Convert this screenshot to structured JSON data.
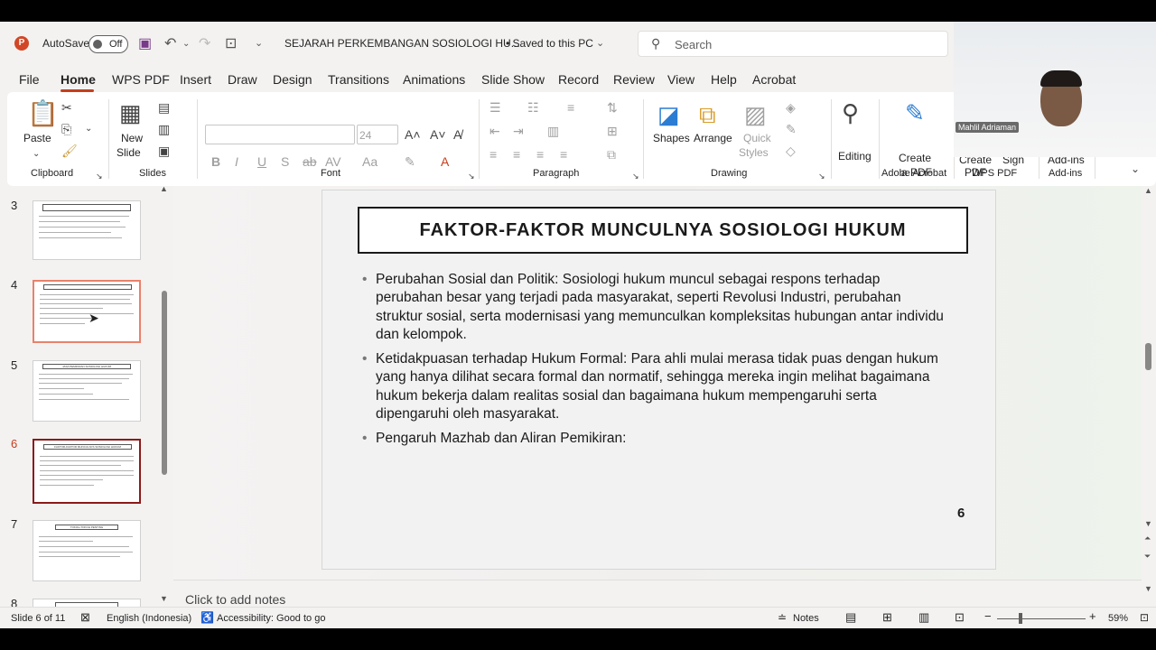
{
  "app": {
    "logo": "P",
    "autosave_label": "AutoSave",
    "autosave_state": "Off",
    "doc_title": "SEJARAH PERKEMBANGAN SOSIOLOGI HU...",
    "saved_status": "• Saved to this PC",
    "search_placeholder": "Search"
  },
  "tabs": [
    "File",
    "Home",
    "WPS PDF",
    "Insert",
    "Draw",
    "Design",
    "Transitions",
    "Animations",
    "Slide Show",
    "Record",
    "Review",
    "View",
    "Help",
    "Acrobat"
  ],
  "ribbon": {
    "clipboard": {
      "paste": "Paste",
      "label": "Clipboard"
    },
    "slides": {
      "new_slide_1": "New",
      "new_slide_2": "Slide",
      "label": "Slides"
    },
    "font": {
      "size": "24",
      "label": "Font"
    },
    "paragraph": {
      "label": "Paragraph"
    },
    "drawing": {
      "shapes": "Shapes",
      "arrange": "Arrange",
      "quick_styles_1": "Quick",
      "quick_styles_2": "Styles",
      "label": "Drawing"
    },
    "editing": {
      "label": "Editing"
    },
    "acrobat": {
      "create_1": "Create",
      "create_2": "a PDF",
      "label": "Adobe Acrobat"
    },
    "wps": {
      "create_1": "Create",
      "create_2": "PDF",
      "sign": "Sign",
      "label": "WPS PDF"
    },
    "addins": {
      "btn": "Add-ins",
      "label": "Add-ins"
    }
  },
  "thumbnails": [
    {
      "num": "3",
      "title": ""
    },
    {
      "num": "4",
      "title": ""
    },
    {
      "num": "5",
      "title": "JASA PEMIKIRAN SOSIOLOGI HUKUM"
    },
    {
      "num": "6",
      "title": "FAKTOR-FAKTOR MUNCULNYA SOSIOLOGI HUKUM"
    },
    {
      "num": "7",
      "title": "TOKOH-TOKOH PENTING"
    },
    {
      "num": "8",
      "title": ""
    }
  ],
  "slide": {
    "title": "FAKTOR-FAKTOR MUNCULNYA SOSIOLOGI HUKUM",
    "bullets": [
      "Perubahan Sosial dan Politik: Sosiologi hukum muncul sebagai respons terhadap perubahan besar yang terjadi pada masyarakat, seperti Revolusi Industri, perubahan struktur sosial, serta modernisasi yang memunculkan kompleksitas hubungan antar individu dan kelompok.",
      "Ketidakpuasan terhadap Hukum Formal: Para ahli mulai merasa tidak puas dengan hukum yang hanya dilihat secara formal dan normatif, sehingga mereka ingin melihat bagaimana hukum bekerja dalam realitas sosial dan bagaimana hukum mempengaruhi serta dipengaruhi oleh masyarakat.",
      "Pengaruh Mazhab dan Aliran Pemikiran:"
    ],
    "page_number": "6"
  },
  "notes_placeholder": "Click to add notes",
  "status": {
    "slide_info": "Slide 6 of 11",
    "language": "English (Indonesia)",
    "accessibility": "Accessibility: Good to go",
    "notes": "Notes",
    "zoom": "59%"
  },
  "webcam": {
    "name": "Mahlil Adriaman"
  },
  "colors": {
    "accent": "#c43e1c",
    "selected_thumb": "#8b1a1a"
  }
}
